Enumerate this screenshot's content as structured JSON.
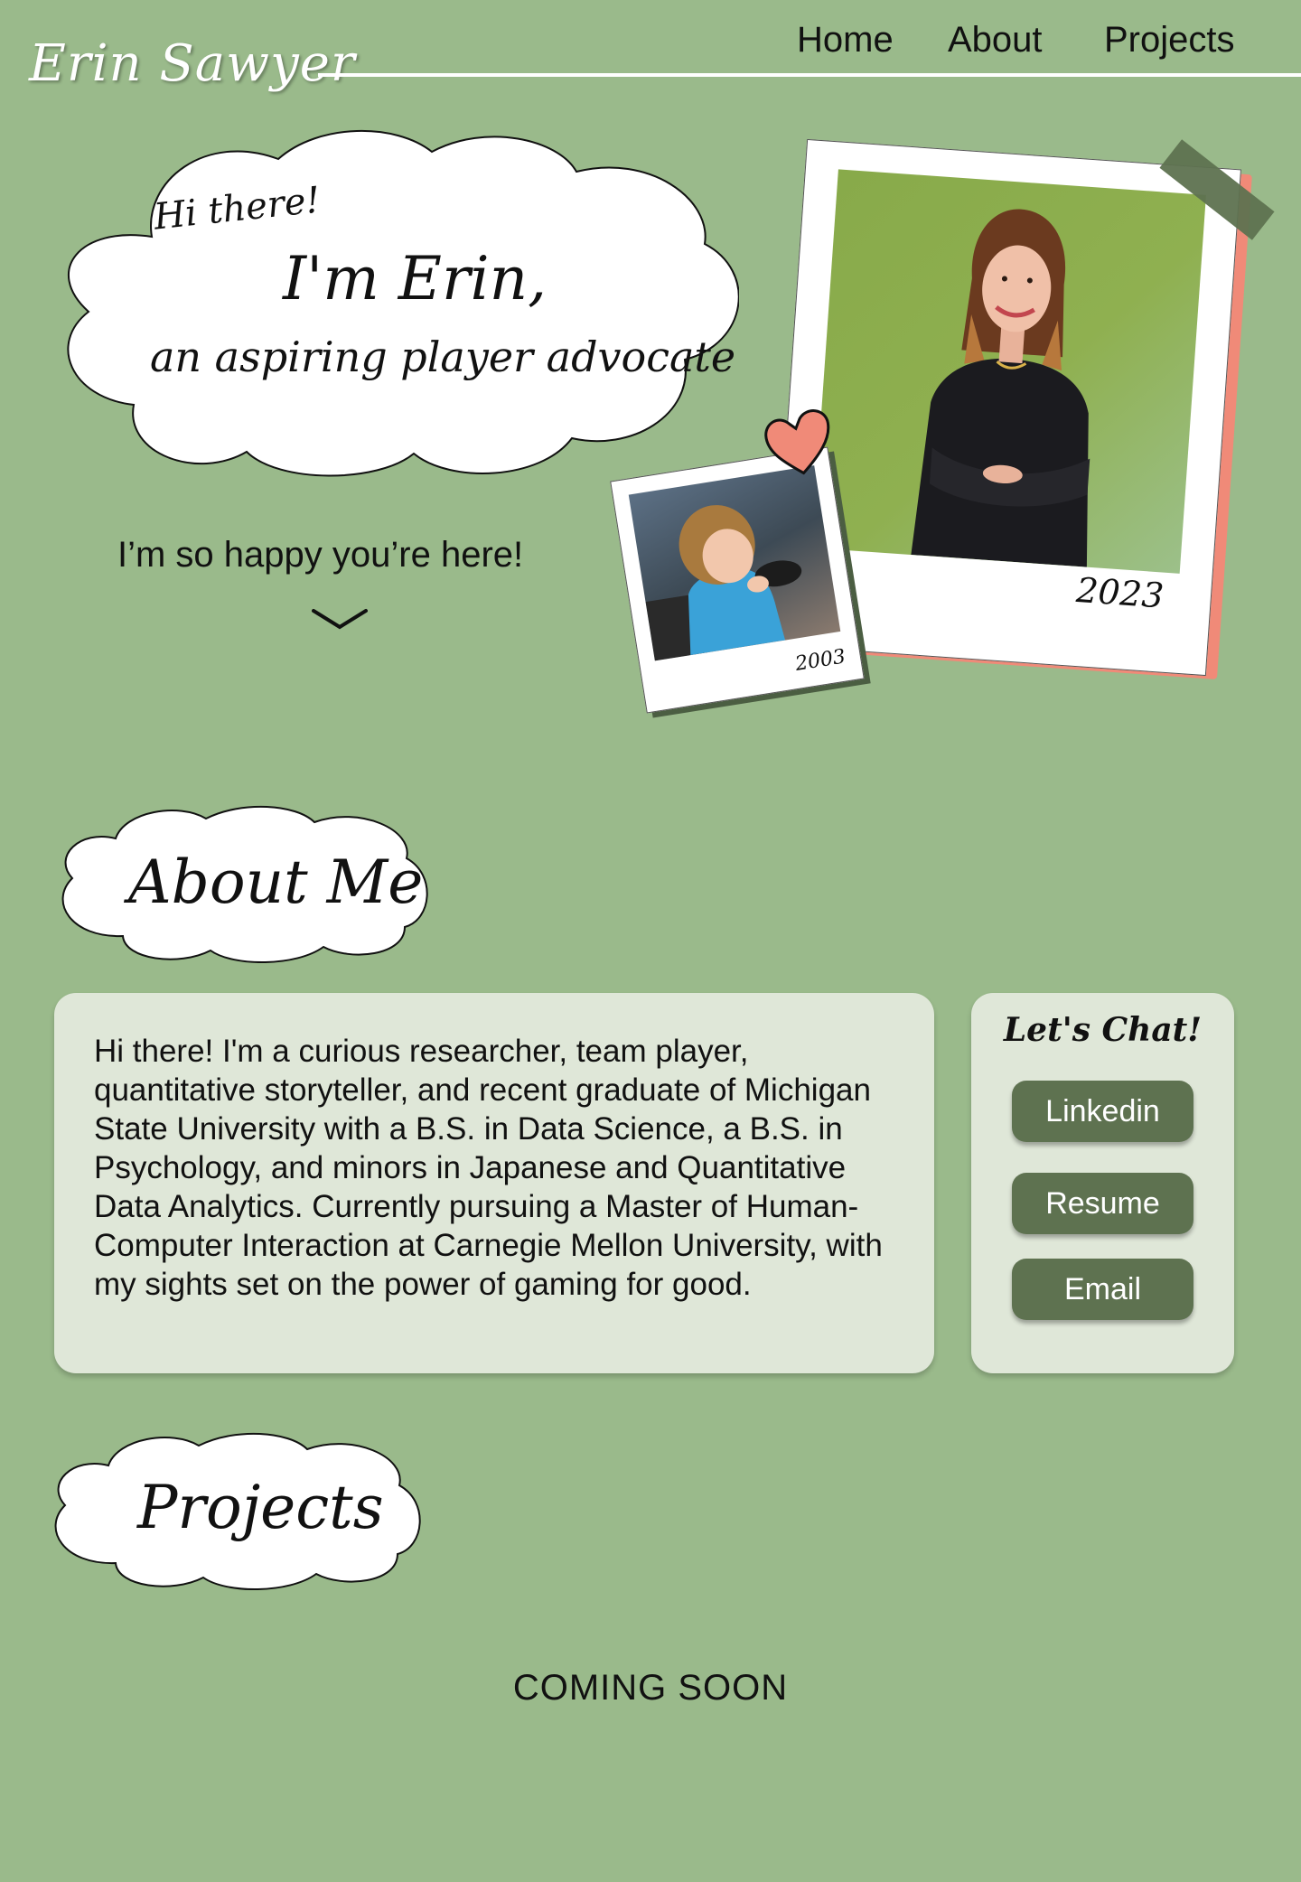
{
  "header": {
    "logo": "Erin Sawyer",
    "nav": [
      "Home",
      "About",
      "Projects"
    ]
  },
  "hero": {
    "greeting": "Hi there!",
    "name_line": "I'm Erin,",
    "tagline": "an aspiring player advocate",
    "happy": "I’m so happy you’re here!",
    "photo_main_year": "2023",
    "photo_small_year": "2003"
  },
  "about": {
    "heading": "About Me",
    "body": "Hi there! I'm a curious researcher, team player, quantitative storyteller, and recent graduate of Michigan State University with a B.S. in Data Science, a B.S. in Psychology, and minors in Japanese and Quantitative Data Analytics. Currently pursuing a Master of Human-Computer Interaction at Carnegie Mellon University, with my sights set on the power of gaming for good."
  },
  "chat": {
    "title": "Let's Chat!",
    "buttons": [
      "Linkedin",
      "Resume",
      "Email"
    ]
  },
  "projects": {
    "heading": "Projects",
    "status": "COMING SOON"
  },
  "colors": {
    "background": "#9aba8b",
    "card": "#dfe7d8",
    "button": "#5e7250",
    "accent_coral": "#f08a78",
    "tape": "#5e7250"
  }
}
